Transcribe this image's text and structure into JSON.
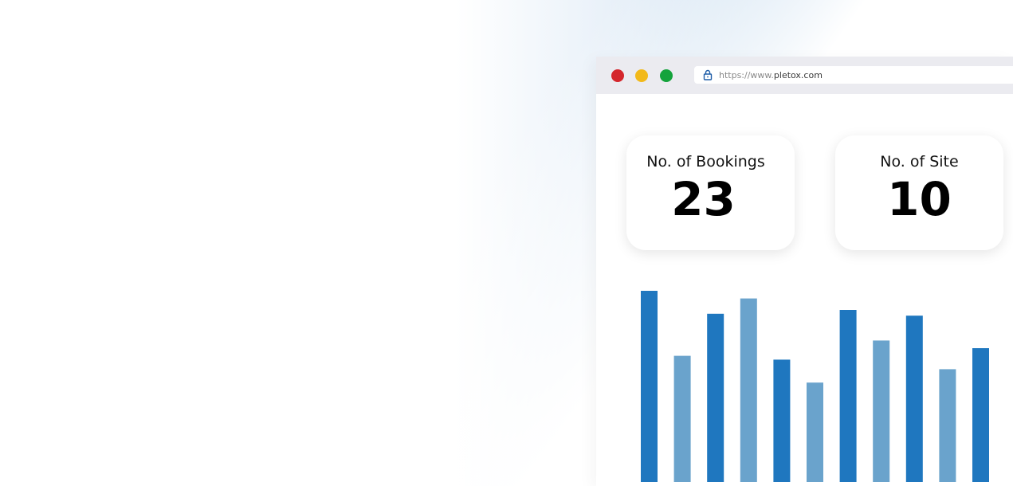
{
  "browser": {
    "url_prefix": "https://www.",
    "url_domain": "pletox.com",
    "controls": [
      "close",
      "minimize",
      "maximize"
    ],
    "colors": {
      "close": "#d4262c",
      "minimize": "#f2b91a",
      "maximize": "#14a33c",
      "toolbar": "#ebebf0"
    },
    "lock_icon": "lock-icon"
  },
  "stats": {
    "bookings": {
      "label": "No. of Bookings",
      "value": "23"
    },
    "sites": {
      "label": "No. of Site",
      "value": "10"
    }
  },
  "chart_data": {
    "type": "bar",
    "title": "",
    "xlabel": "",
    "ylabel": "",
    "grid": false,
    "ylim": [
      0,
      100
    ],
    "values": [
      100,
      66,
      88,
      96,
      64,
      52,
      90,
      74,
      87,
      59,
      70
    ],
    "colors": [
      "#1f77bf",
      "#6aa3cc",
      "#1f77bf",
      "#6aa3cc",
      "#1f77bf",
      "#6aa3cc",
      "#1f77bf",
      "#6aa3cc",
      "#1f77bf",
      "#6aa3cc",
      "#1f77bf"
    ]
  }
}
